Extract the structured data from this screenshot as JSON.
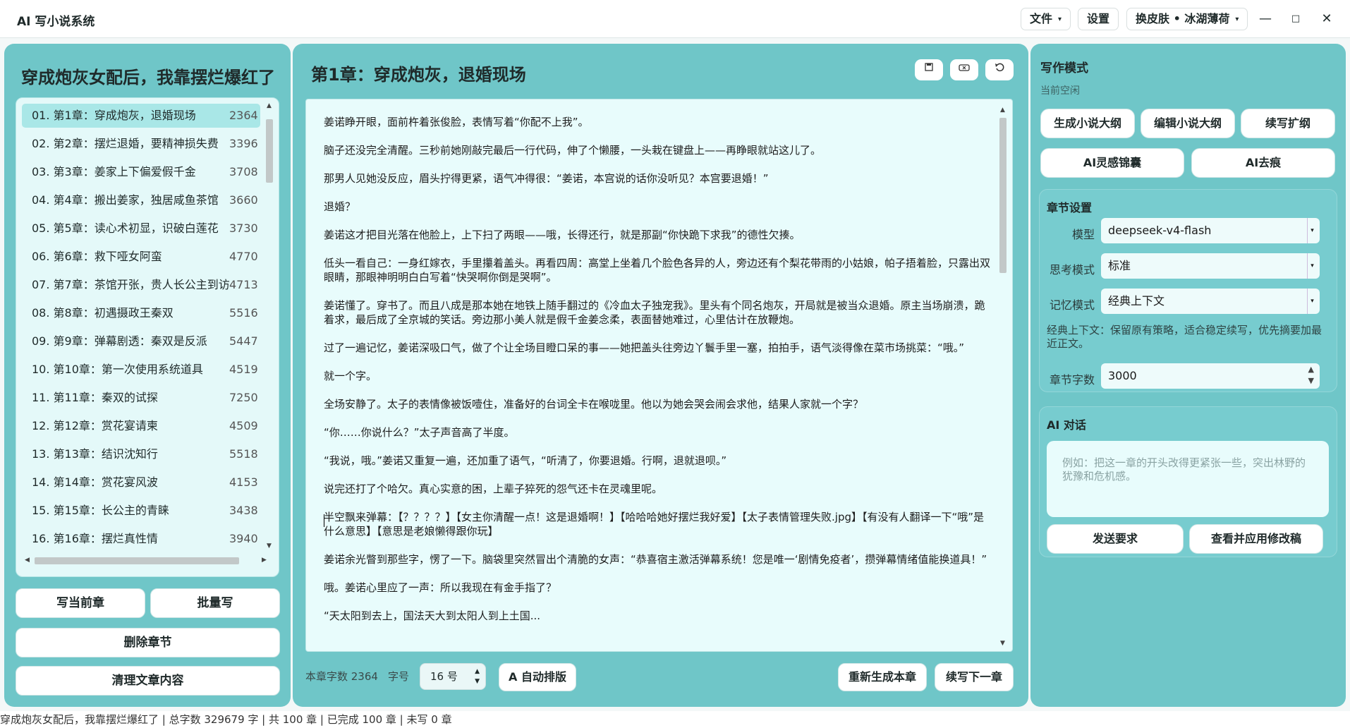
{
  "titlebar": {
    "app_title": "AI 写小说系统",
    "file_menu": "文件",
    "settings": "设置",
    "skin": "换皮肤 • 冰湖薄荷",
    "minimize": "—",
    "maximize": "□",
    "close": "✕"
  },
  "left": {
    "novel_title": "穿成炮灰女配后，我靠摆烂爆红了",
    "chapters": [
      {
        "label": "01. 第1章：穿成炮灰，退婚现场",
        "count": "2364"
      },
      {
        "label": "02. 第2章：摆烂退婚，要精神损失费",
        "count": "3396"
      },
      {
        "label": "03. 第3章：姜家上下偏爱假千金",
        "count": "3708"
      },
      {
        "label": "04. 第4章：搬出姜家，独居咸鱼茶馆",
        "count": "3660"
      },
      {
        "label": "05. 第5章：读心术初显，识破白莲花",
        "count": "3730"
      },
      {
        "label": "06. 第6章：救下哑女阿蛮",
        "count": "4770"
      },
      {
        "label": "07. 第7章：茶馆开张，贵人长公主到访",
        "count": "4713"
      },
      {
        "label": "08. 第8章：初遇摄政王秦双",
        "count": "5516"
      },
      {
        "label": "09. 第9章：弹幕剧透：秦双是反派",
        "count": "5447"
      },
      {
        "label": "10. 第10章：第一次使用系统道具",
        "count": "4519"
      },
      {
        "label": "11. 第11章：秦双的试探",
        "count": "7250"
      },
      {
        "label": "12. 第12章：赏花宴请柬",
        "count": "4509"
      },
      {
        "label": "13. 第13章：结识沈知行",
        "count": "5518"
      },
      {
        "label": "14. 第14章：赏花宴风波",
        "count": "4153"
      },
      {
        "label": "15. 第15章：长公主的青睐",
        "count": "3438"
      },
      {
        "label": "16. 第16章：摆烂真性情",
        "count": "3940"
      }
    ],
    "buttons": {
      "write_current": "写当前章",
      "batch_write": "批量写",
      "delete_chapter": "删除章节",
      "clear_content": "清理文章内容"
    }
  },
  "center": {
    "chapter_title": "第1章：穿成炮灰，退婚现场",
    "paragraphs": [
      "姜诺睁开眼，面前杵着张俊脸，表情写着“你配不上我”。",
      "脑子还没完全清醒。三秒前她刚敲完最后一行代码，伸了个懒腰，一头栽在键盘上——再睁眼就站这儿了。",
      "那男人见她没反应，眉头拧得更紧，语气冲得很：“姜诺，本宫说的话你没听见？本宫要退婚！”",
      "退婚？",
      "姜诺这才把目光落在他脸上，上下扫了两眼——哦，长得还行，就是那副“你快跪下求我”的德性欠揍。",
      "低头一看自己：一身红嫁衣，手里攥着盖头。再看四周：高堂上坐着几个脸色各异的人，旁边还有个梨花带雨的小姑娘，帕子捂着脸，只露出双眼睛，那眼神明明白白写着“快哭啊你倒是哭啊”。",
      "姜诺懂了。穿书了。而且八成是那本她在地铁上随手翻过的《冷血太子独宠我》。里头有个同名炮灰，开局就是被当众退婚。原主当场崩溃，跪着求，最后成了全京城的笑话。旁边那小美人就是假千金姜念柔，表面替她难过，心里估计在放鞭炮。",
      "过了一遍记忆，姜诺深吸口气，做了个让全场目瞪口呆的事——她把盖头往旁边丫鬟手里一塞，拍拍手，语气淡得像在菜市场挑菜：“哦。”",
      "就一个字。",
      "全场安静了。太子的表情像被饭噎住，准备好的台词全卡在喉咙里。他以为她会哭会闹会求他，结果人家就一个字？",
      "“你……你说什么？”太子声音高了半度。",
      "“我说，哦。”姜诺又重复一遍，还加重了语气，“听清了，你要退婚。行啊，退就退呗。”",
      "说完还打了个哈欠。真心实意的困，上辈子猝死的怨气还卡在灵魂里呢。",
      "半空飘来弹幕：【？？？？】【女主你清醒一点！这是退婚啊！】【哈哈哈她好摆烂我好爱】【太子表情管理失败.jpg】【有没有人翻译一下“哦”是什么意思】【意思是老娘懒得跟你玩】",
      "姜诺余光瞥到那些字，愣了一下。脑袋里突然冒出个清脆的女声：“恭喜宿主激活弹幕系统！您是唯一‘剧情免疫者’，攒弹幕情绪值能换道具！”",
      "哦。姜诺心里应了一声：所以我现在有金手指了？",
      "“天太阳到去上，国法天大到太阳人到上土国..."
    ],
    "word_count": "本章字数 2364",
    "font_label": "字号",
    "font_size": "16 号",
    "auto_layout": "A 自动排版",
    "regen": "重新生成本章",
    "continue": "续写下一章",
    "icons": [
      "save-icon",
      "clear-icon",
      "undo-icon"
    ]
  },
  "right": {
    "mode_title": "写作模式",
    "mode_status": "当前空闲",
    "gen_outline": "生成小说大纲",
    "edit_outline": "编辑小说大纲",
    "expand": "续写扩纲",
    "inspiration": "AI灵感锦囊",
    "dedup": "AI去痕",
    "settings_title": "章节设置",
    "model_label": "模型",
    "model_value": "deepseek-v4-flash",
    "think_label": "思考模式",
    "think_value": "标准",
    "memory_label": "记忆模式",
    "memory_value": "经典上下文",
    "memory_hint": "经典上下文：保留原有策略，适合稳定续写，优先摘要加最近正文。",
    "words_label": "章节字数",
    "words_value": "3000",
    "chat_title": "AI 对话",
    "chat_placeholder": "例如：把这一章的开头改得更紧张一些，突出林野的犹豫和危机感。",
    "send": "发送要求",
    "apply": "查看并应用修改稿"
  },
  "statusbar": "穿成炮灰女配后，我靠摆烂爆红了 | 总字数 329679 字 | 共 100 章 | 已完成 100 章 | 未写 0 章"
}
